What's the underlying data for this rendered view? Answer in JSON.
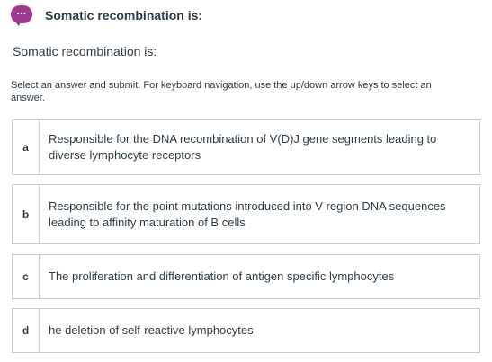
{
  "header": {
    "icon": "chat-bubble-ellipsis-icon",
    "icon_glyph": "···",
    "icon_color": "#9b3a8e",
    "title": "Somatic recombination is:"
  },
  "question": {
    "text": "Somatic recombination is:"
  },
  "instructions": "Select an answer and submit. For keyboard navigation, use the up/down arrow keys to select an answer.",
  "options": [
    {
      "letter": "a",
      "text": "Responsible for the DNA recombination of V(D)J gene segments leading to diverse lymphocyte receptors"
    },
    {
      "letter": "b",
      "text": "Responsible for the point mutations introduced into V region DNA sequences leading to affinity maturation of B cells"
    },
    {
      "letter": "c",
      "text": "The proliferation and differentiation of antigen specific lymphocytes"
    },
    {
      "letter": "d",
      "text": "he deletion of self-reactive lymphocytes"
    }
  ],
  "colors": {
    "text": "#2d3b45",
    "border": "#c7cdd1",
    "accent": "#9b3a8e"
  }
}
